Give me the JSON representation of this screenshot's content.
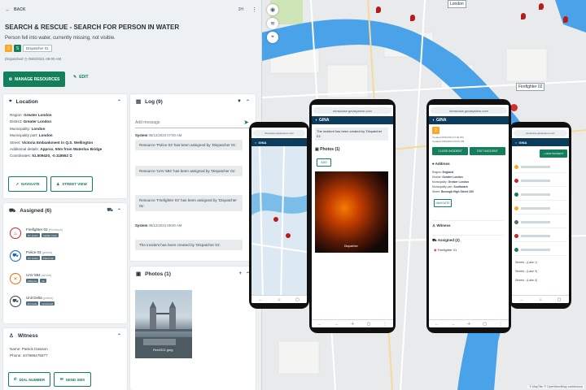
{
  "topbar": {
    "back": "BACK",
    "time": "2H"
  },
  "incident": {
    "title": "SEARCH & RESCUE - SEARCH FOR PERSON IN WATER",
    "description": "Person fell into water, currently missing, not visible.",
    "priority_badge": "2",
    "category_badge": "S",
    "dispatcher_chip": "Dispatcher 01",
    "dispatched_label": "Dispatched",
    "dispatched_time": "05/6/2021 09:00 AM"
  },
  "actions": {
    "manage_resources": "MANAGE RESOURCES",
    "edit": "EDIT"
  },
  "location": {
    "title": "Location",
    "fields": [
      {
        "k": "Region:",
        "v": "Greater London"
      },
      {
        "k": "District:",
        "v": "Greater London"
      },
      {
        "k": "Municipality:",
        "v": "London"
      },
      {
        "k": "Municipality part:",
        "v": "London"
      },
      {
        "k": "Street:",
        "v": "Victoria Embankment in Q.S. Wellington"
      },
      {
        "k": "Additional details:",
        "v": "Approx. 50m from Waterloo Bridge"
      },
      {
        "k": "Coordinates:",
        "v": "51.509420, -0.118652"
      }
    ],
    "navigate": "NAVIGATE",
    "street_view": "STREET VIEW"
  },
  "assigned": {
    "title": "Assigned (6)",
    "items": [
      {
        "name": "Firefighter 02",
        "status": "(Firetruck)",
        "tags": [
          "On scene",
          "Ladder truck"
        ],
        "color": "#c62828",
        "icon": "fire-icon"
      },
      {
        "name": "Police 03",
        "status": "(police)",
        "tags": [
          "On scene",
          "Patrol car"
        ],
        "color": "#1565c0",
        "icon": "police-car-icon"
      },
      {
        "name": "UAV 584",
        "status": "(drone)",
        "tags": [
          "Airborne",
          "Air"
        ],
        "color": "#ef6c00",
        "icon": "drone-icon"
      },
      {
        "name": "Unit Delta",
        "status": "(police)",
        "tags": [
          "En route",
          "Command"
        ],
        "color": "#37474f",
        "icon": "unit-icon"
      }
    ]
  },
  "witness": {
    "title": "Witness",
    "name_k": "Name:",
    "name_v": "Patrick Dawson",
    "phone_k": "Phone:",
    "phone_v": "447986475577",
    "dial": "DIAL NUMBER",
    "sms": "SEND SMS"
  },
  "log": {
    "title": "Log (9)",
    "placeholder": "Add message",
    "entries": [
      {
        "user": "System",
        "time": "05/12/2023 07:00 AM",
        "text": "Resource 'Police 03' has been assigned by 'Dispatcher 01'."
      },
      {
        "user": "",
        "time": "",
        "text": "Resource 'UAV 584' has been assigned by 'Dispatcher 01'."
      },
      {
        "user": "",
        "time": "",
        "text": "Resource 'Firefighter 02' has been assigned by 'Dispatcher 01'."
      },
      {
        "user": "System",
        "time": "05/12/2023 09:00 AM",
        "text": "The incident has been created by 'Dispatcher 01'."
      }
    ]
  },
  "photos": {
    "title": "Photos (1)",
    "caption": "Fire2021.jpeg"
  },
  "map": {
    "city_label": "London",
    "firefighter_label": "Firefighter 02",
    "attribution": "© MapTiler © OpenStreetMap contributors"
  },
  "phones": {
    "url": "showcase.ginasystem.com",
    "brand": "GINA",
    "p2_text": "The incident has been created by 'Dispatcher 01'.",
    "p2_photos": "Photos (1)",
    "p2_add": "ADD",
    "p2_caption": "Dispatcher",
    "p3_badge": "2",
    "p3_created": "Created 05/6/2023 07:00 PM",
    "p3_updated": "Updated 05/6/2023 09:00 PM",
    "p3_close": "CLOSE INCIDENT",
    "p3_edit": "EDIT INCIDENT",
    "p3_address": "Address",
    "p3_fields": [
      {
        "k": "Region:",
        "v": "England"
      },
      {
        "k": "District:",
        "v": "Greater London"
      },
      {
        "k": "Municipality:",
        "v": "Greater London"
      },
      {
        "k": "Municipality part:",
        "v": "Southwark"
      },
      {
        "k": "Street:",
        "v": "Borough High Street 150"
      }
    ],
    "p3_navigate": "NAVIGATE",
    "p3_witness": "Witness",
    "p3_assigned": "Assigned (2)",
    "p3_ff": "Firefighter 01",
    "p4_new": "+ NEW INCIDENT",
    "p4_streets": [
      "Streets - (Lake 1)",
      "Streets - (Lake 3)",
      "Streets - (Lake 4)"
    ]
  },
  "colors": {
    "accent": "#137f5b",
    "brand": "#0d3b5c",
    "river": "#4aa3e8",
    "marker": "#b71c1c"
  }
}
